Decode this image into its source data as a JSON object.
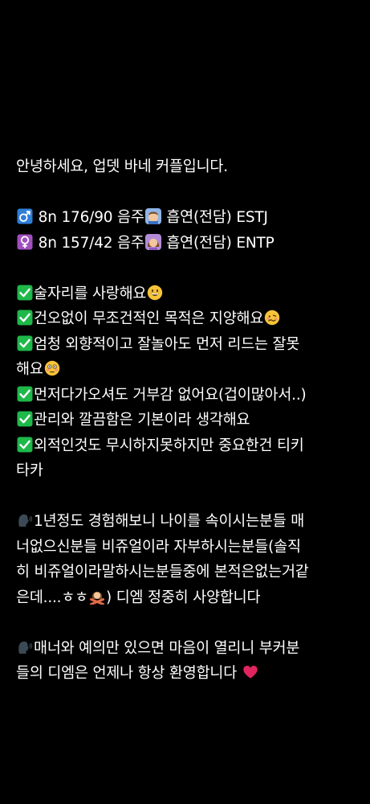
{
  "post": {
    "greeting": "안녕하세요, 업뎃 바네 커플입니다.",
    "male": {
      "symbol": "♂",
      "text_a": " 8n 176/90 음주",
      "text_b": " 흡연(전담) ESTJ"
    },
    "female": {
      "symbol": "♀",
      "text_a": " 8n 157/42 음주",
      "text_b": " 흡연(전담) ENTP"
    },
    "checks": [
      {
        "text": "술자리를 사랑해요",
        "emoji": "grinning-face-icon"
      },
      {
        "text": "건오없이 무조건적인 목적은 지양해요",
        "emoji": "woozy-face-icon"
      },
      {
        "text": "엄청 외향적이고 잘놀아도 먼저 리드는 잘못",
        "text2": "해요",
        "emoji": "flushed-face-icon"
      },
      {
        "text": "먼저다가오셔도 거부감 없어요(겁이많아서..)"
      },
      {
        "text": "관리와 깔끔함은 기본이라 생각해요"
      },
      {
        "text": "외적인것도 무시하지못하지만 중요한건 티키",
        "text2": "타카"
      }
    ],
    "para1": {
      "l1": "1년정도 경험해보니 나이를 속이시는분들 매",
      "l2": "너없으신분들 비쥬얼이라 자부하시는분들(솔직",
      "l3": "히 비쥬얼이라말하시는분들중에 본적은없는거같",
      "l4a": "은데....ㅎㅎ",
      "l4b": ") 디엠 정중히 사양합니다"
    },
    "para2": {
      "l1": "매너와 예의만 있으면 마음이 열리니 부커분",
      "l2": "들의 디엠은 언제나 항상 환영합니다 "
    }
  },
  "colors": {
    "background": "#000000",
    "text": "#ffffff",
    "check_green": "#1fb84a",
    "male_box": "#2f7ed8",
    "female_box": "#a14fbf",
    "heart": "#e0245e"
  }
}
